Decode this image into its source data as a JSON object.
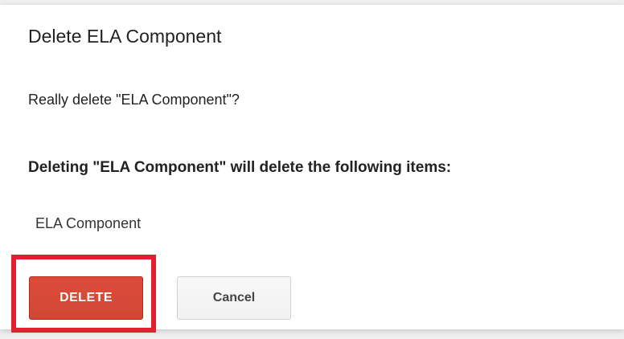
{
  "dialog": {
    "title": "Delete ELA Component",
    "confirm_text": "Really delete \"ELA Component\"?",
    "warning_text": "Deleting \"ELA Component\" will delete the following items:",
    "items": [
      "ELA Component"
    ]
  },
  "buttons": {
    "delete_label": "DELETE",
    "cancel_label": "Cancel"
  },
  "colors": {
    "delete_button": "#d14836",
    "highlight_box": "#e3202f",
    "cancel_button": "#f5f5f5"
  }
}
